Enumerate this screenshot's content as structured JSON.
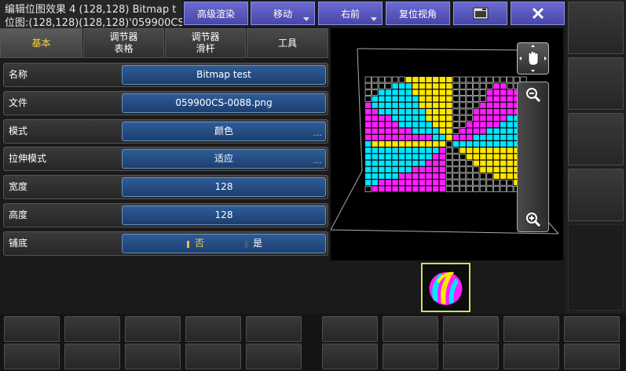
{
  "window": {
    "title_line1": "编辑位图效果 4 (128,128) Bitmap t",
    "title_line2": "位图:(128,128)(128,128)'059900CS"
  },
  "toolbar": {
    "buttons": [
      {
        "id": "advanced-render",
        "label": "高级渲染",
        "dropdown": false
      },
      {
        "id": "move",
        "label": "移动",
        "dropdown": true
      },
      {
        "id": "right-front",
        "label": "右前",
        "dropdown": true
      },
      {
        "id": "reset-view",
        "label": "复位视角",
        "dropdown": false
      },
      {
        "id": "window-menu",
        "label": "",
        "icon": "window-menu-icon",
        "dropdown": false
      },
      {
        "id": "close",
        "label": "",
        "icon": "close-icon",
        "dropdown": false
      }
    ]
  },
  "tabs": [
    {
      "line1": "基本",
      "line2": "",
      "active": true
    },
    {
      "line1": "调节器",
      "line2": "表格",
      "active": false
    },
    {
      "line1": "调节器",
      "line2": "滑杆",
      "active": false
    },
    {
      "line1": "工具",
      "line2": "",
      "active": false
    }
  ],
  "properties": {
    "name": {
      "label": "名称",
      "value": "Bitmap test"
    },
    "file": {
      "label": "文件",
      "value": "059900CS-0088.png"
    },
    "mode": {
      "label": "模式",
      "value": "颜色",
      "dropdown": true
    },
    "stretch_mode": {
      "label": "拉伸模式",
      "value": "适应",
      "dropdown": true
    },
    "width": {
      "label": "宽度",
      "value": "128"
    },
    "height": {
      "label": "高度",
      "value": "128"
    },
    "tile": {
      "label": "铺底",
      "option_no": "否",
      "option_yes": "是",
      "selected": "否"
    }
  },
  "dropdown_hint": "....",
  "colors": {
    "accent_tab": "#ffd23c",
    "field_blue": "#2e5c98",
    "toolbar_purple": "#5757bb",
    "pixel_magenta": "#ff1eff",
    "pixel_cyan": "#00e6ff",
    "pixel_yellow": "#ffe600",
    "thumb_border": "#c8e070"
  },
  "viewport": {
    "icons": [
      "pan-hand-icon",
      "zoom-out-icon",
      "zoom-in-icon"
    ]
  },
  "thumbnail": {
    "icon": "bitmap-preview-icon"
  }
}
